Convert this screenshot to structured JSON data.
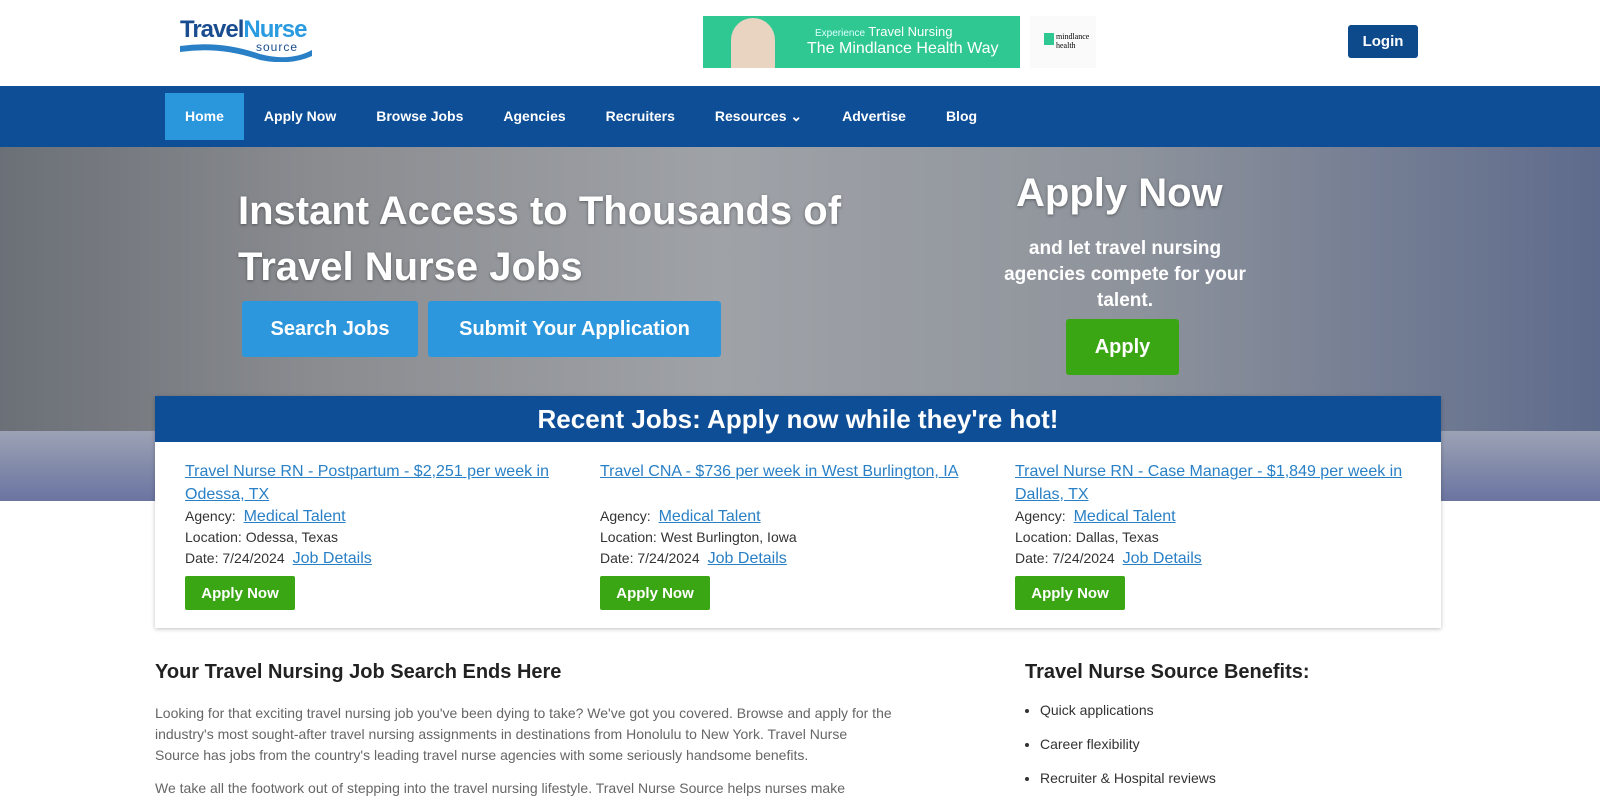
{
  "header": {
    "logo_text_1": "Travel",
    "logo_text_2": "Nurse",
    "logo_text_3": "source",
    "ad_line1_small": "Experience",
    "ad_line1": "Travel Nursing",
    "ad_line2": "The Mindlance Health Way",
    "ad_brand": "mindlance health",
    "login": "Login"
  },
  "nav": [
    "Home",
    "Apply Now",
    "Browse Jobs",
    "Agencies",
    "Recruiters",
    "Resources ⌄",
    "Advertise",
    "Blog"
  ],
  "hero": {
    "title": "Instant Access to Thousands of Travel Nurse Jobs",
    "search": "Search Jobs",
    "submit": "Submit Your Application",
    "apply_title": "Apply Now",
    "apply_sub": "and let travel nursing agencies compete for your talent.",
    "apply_btn": "Apply"
  },
  "recent": {
    "heading": "Recent Jobs: Apply now while they're hot!",
    "agency_label": "Agency:",
    "details": "Job Details",
    "apply": "Apply Now",
    "jobs": [
      {
        "title": "Travel Nurse RN - Postpartum - $2,251 per week in Odessa, TX",
        "agency": "Medical Talent",
        "location": "Location: Odessa, Texas",
        "date": "Date: 7/24/2024"
      },
      {
        "title": "Travel CNA - $736 per week in West Burlington, IA",
        "agency": "Medical Talent",
        "location": "Location: West Burlington, Iowa",
        "date": "Date: 7/24/2024"
      },
      {
        "title": "Travel Nurse RN - Case Manager - $1,849 per week in Dallas, TX",
        "agency": "Medical Talent",
        "location": "Location: Dallas, Texas",
        "date": "Date: 7/24/2024"
      }
    ]
  },
  "content": {
    "heading": "Your Travel Nursing Job Search Ends Here",
    "p1": "Looking for that exciting travel nursing job you've been dying to take? We've got you covered. Browse and apply for the industry's most sought-after travel nursing assignments in destinations from Honolulu to New York. Travel Nurse Source has jobs from the country's leading travel nurse agencies with some seriously handsome benefits.",
    "p2": "We take all the footwork out of stepping into the travel nursing lifestyle. Travel Nurse Source helps nurses make"
  },
  "benefits": {
    "heading": "Travel Nurse Source Benefits:",
    "items": [
      "Quick applications",
      "Career flexibility",
      "Recruiter & Hospital reviews"
    ]
  }
}
